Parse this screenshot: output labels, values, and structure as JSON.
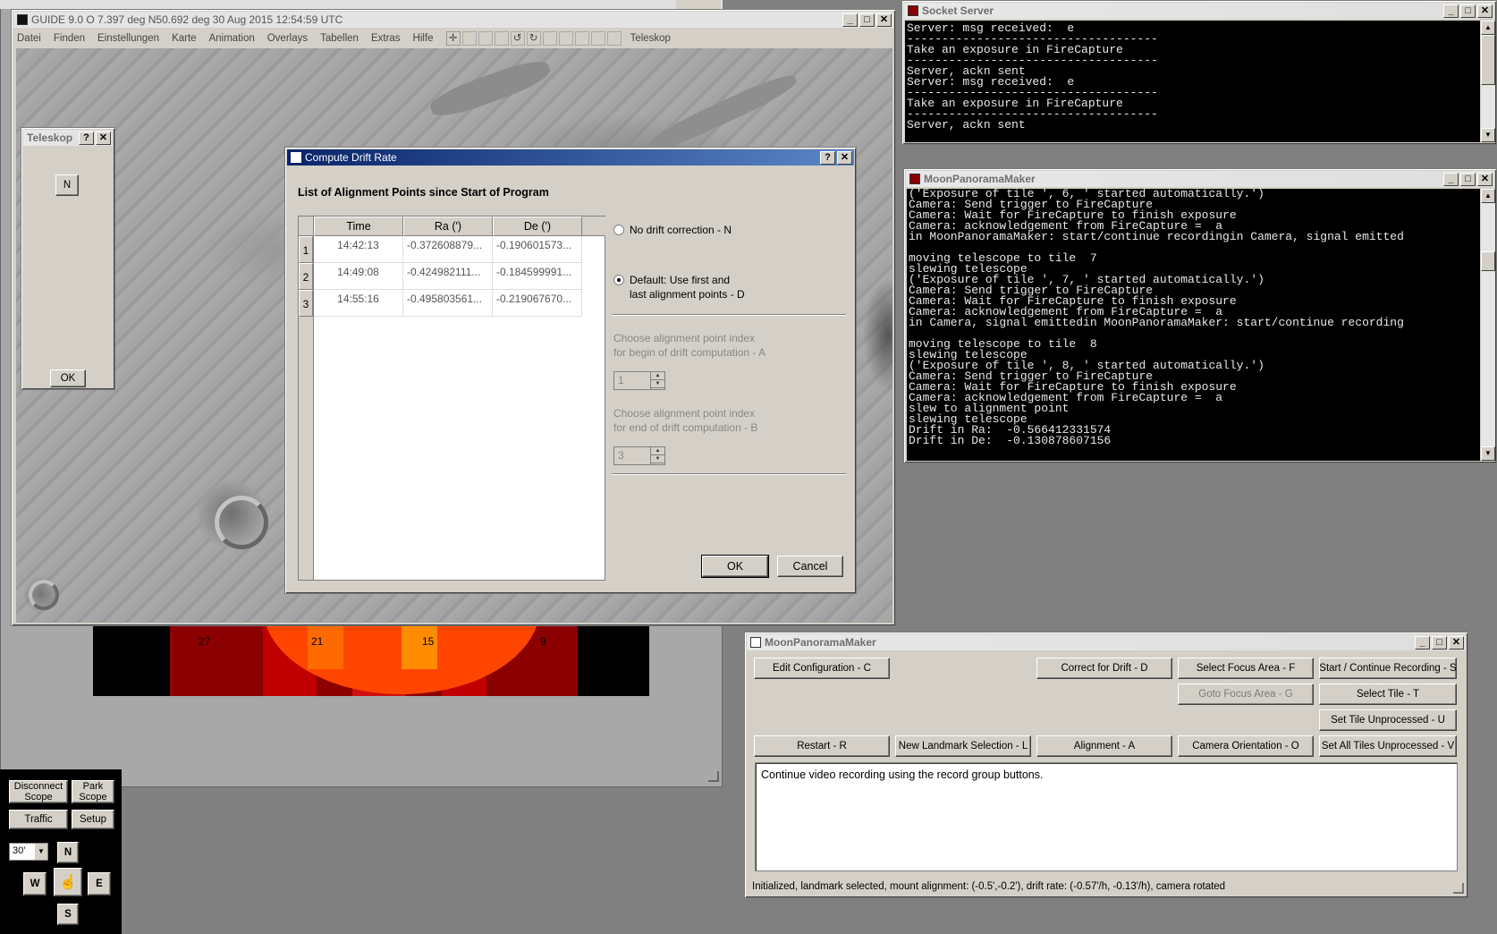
{
  "guide_window": {
    "title": "GUIDE 9.0   O  7.397 deg N50.692 deg    30 Aug 2015 12:54:59 UTC",
    "menu": [
      "Datei",
      "Finden",
      "Einstellungen",
      "Karte",
      "Animation",
      "Overlays",
      "Tabellen",
      "Extras",
      "Hilfe"
    ],
    "toolbar_label": "Teleskop",
    "heat_labels": [
      "27",
      "21",
      "15",
      "9"
    ]
  },
  "teleskop_panel": {
    "title": "Teleskop",
    "help": "?",
    "close": "✕",
    "n_button": "N",
    "ok_button": "OK"
  },
  "scope_panel": {
    "disconnect": "Disconnect\nScope",
    "park": "Park\nScope",
    "traffic": "Traffic",
    "setup": "Setup",
    "zoom": "30'",
    "n": "N",
    "w": "W",
    "e": "E",
    "s": "S"
  },
  "socket_server": {
    "title": "Socket Server",
    "lines": [
      "Server: msg received:  e",
      "------------------------------------",
      "Take an exposure in FireCapture",
      "------------------------------------",
      "Server, ackn sent",
      "Server: msg received:  e",
      "------------------------------------",
      "Take an exposure in FireCapture",
      "------------------------------------",
      "Server, ackn sent"
    ]
  },
  "moon_console": {
    "title": "MoonPanoramaMaker",
    "lines": [
      "('Exposure of tile ', 6, ' started automatically.')",
      "Camera: Send trigger to FireCapture",
      "Camera: Wait for FireCapture to finish exposure",
      "Camera: acknowledgement from FireCapture =  a",
      "in MoonPanoramaMaker: start/continue recordingin Camera, signal emitted",
      "",
      "moving telescope to tile  7",
      "slewing telescope",
      "('Exposure of tile ', 7, ' started automatically.')",
      "Camera: Send trigger to FireCapture",
      "Camera: Wait for FireCapture to finish exposure",
      "Camera: acknowledgement from FireCapture =  a",
      "in Camera, signal emittedin MoonPanoramaMaker: start/continue recording",
      "",
      "moving telescope to tile  8",
      "slewing telescope",
      "('Exposure of tile ', 8, ' started automatically.')",
      "Camera: Send trigger to FireCapture",
      "Camera: Wait for FireCapture to finish exposure",
      "Camera: acknowledgement from FireCapture =  a",
      "slew to alignment point",
      "slewing telescope",
      "Drift in Ra:  -0.566412331574",
      "Drift in De:  -0.130878607156"
    ]
  },
  "drift_dialog": {
    "title": "Compute Drift Rate",
    "heading": "List of Alignment Points since Start of Program",
    "columns": [
      "Time",
      "Ra (')",
      "De (')"
    ],
    "rows": [
      {
        "idx": "1",
        "time": "14:42:13",
        "ra": "-0.372608879...",
        "de": "-0.190601573..."
      },
      {
        "idx": "2",
        "time": "14:49:08",
        "ra": "-0.424982111...",
        "de": "-0.184599991..."
      },
      {
        "idx": "3",
        "time": "14:55:16",
        "ra": "-0.495803561...",
        "de": "-0.219067670..."
      }
    ],
    "radio_none": "No drift correction - N",
    "radio_default_1": "Default: Use first and",
    "radio_default_2": "last alignment points - D",
    "begin_label_1": "Choose alignment point index",
    "begin_label_2": "for begin of drift computation - A",
    "begin_value": "1",
    "end_label_1": "Choose alignment point index",
    "end_label_2": "for end of drift computation - B",
    "end_value": "3",
    "ok": "OK",
    "cancel": "Cancel"
  },
  "moon_main": {
    "title": "MoonPanoramaMaker",
    "buttons": {
      "edit_config": "Edit Configuration - C",
      "correct_drift": "Correct for Drift - D",
      "select_focus": "Select Focus Area - F",
      "start_recording": "Start / Continue Recording - S",
      "goto_focus": "Goto Focus Area - G",
      "select_tile": "Select Tile - T",
      "set_tile_unprocessed": "Set Tile Unprocessed - U",
      "restart": "Restart - R",
      "new_landmark": "New Landmark Selection - L",
      "alignment": "Alignment - A",
      "camera_orientation": "Camera Orientation - O",
      "set_all_unprocessed": "Set All Tiles Unprocessed - V"
    },
    "message": "Continue video recording using the record group buttons.",
    "status": "Initialized, landmark selected, mount alignment: (-0.5',-0.2'), drift rate: (-0.57'/h, -0.13'/h), camera rotated"
  }
}
